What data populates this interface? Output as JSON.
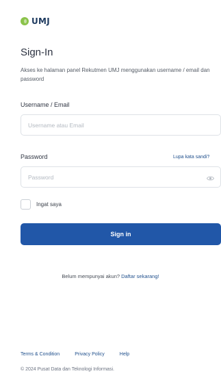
{
  "brand": {
    "logo_text": "UMJ",
    "logo_icon": "globe-logo-icon",
    "colors": {
      "primary": "#2157a8",
      "logo_green": "#8bc34a",
      "link": "#1f4f8c"
    }
  },
  "header": {
    "title": "Sign-In",
    "description": "Akses ke halaman panel Rekutmen UMJ menggunakan username / email dan password"
  },
  "form": {
    "username": {
      "label": "Username / Email",
      "placeholder": "Username atau Email",
      "value": ""
    },
    "password": {
      "label": "Password",
      "placeholder": "Password",
      "value": "",
      "toggle_icon": "eye-icon"
    },
    "forgot_label": "Lupa kata sandi?",
    "remember_label": "Ingat saya",
    "remember_checked": false,
    "submit_label": "Sign in"
  },
  "register": {
    "prompt": "Belum mempunyai akun?",
    "link": "Daftar sekarang!"
  },
  "footer": {
    "links": [
      "Terms & Condition",
      "Privacy Policy",
      "Help"
    ],
    "copyright": "© 2024 Pusat Data dan Teknologi Informasi."
  }
}
